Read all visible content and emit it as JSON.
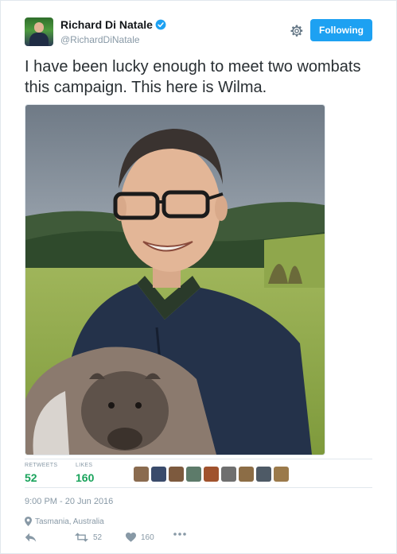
{
  "author": {
    "display_name": "Richard Di Natale",
    "handle": "@RichardDiNatale",
    "verified": true
  },
  "follow_button": {
    "label": "Following"
  },
  "tweet": {
    "text": "I have been lucky enough to meet two wombats this campaign. This here is Wilma."
  },
  "stats": {
    "retweets_label": "RETWEETS",
    "retweets_count": "52",
    "likes_label": "LIKES",
    "likes_count": "160"
  },
  "likers": [
    {
      "color": "#8a6b4f"
    },
    {
      "color": "#3a4b6b"
    },
    {
      "color": "#7d5a3e"
    },
    {
      "color": "#5d7b6a"
    },
    {
      "color": "#a0522d"
    },
    {
      "color": "#6f6f6f"
    },
    {
      "color": "#8c6d46"
    },
    {
      "color": "#4e5a66"
    },
    {
      "color": "#9b7a4b"
    }
  ],
  "meta": {
    "timestamp": "9:00 PM - 20 Jun 2016",
    "location": "Tasmania, Australia"
  },
  "actions": {
    "retweet_count": "52",
    "like_count": "160"
  },
  "colors": {
    "accent": "#1da1f2",
    "stat_green": "#19a35b",
    "muted": "#8899a6"
  }
}
